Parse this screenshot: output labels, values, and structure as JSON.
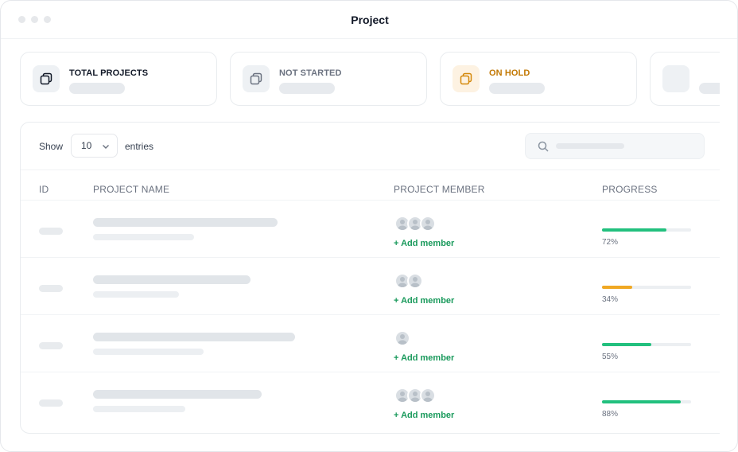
{
  "window": {
    "title": "Project"
  },
  "cards": [
    {
      "label": "TOTAL PROJECTS",
      "icon": "stack-icon",
      "color": "#111827"
    },
    {
      "label": "NOT STARTED",
      "icon": "stack-icon",
      "color": "#6b7280"
    },
    {
      "label": "ON HOLD",
      "icon": "stack-icon",
      "color": "#c27803"
    },
    {
      "label": "",
      "icon": "",
      "color": "#6b7280"
    }
  ],
  "controls": {
    "show_label": "Show",
    "entries_value": "10",
    "entries_label": "entries",
    "search_icon": "search-icon"
  },
  "table": {
    "headers": {
      "id": "ID",
      "name": "PROJECT NAME",
      "member": "PROJECT MEMBER",
      "progress": "PROGRESS"
    },
    "add_member_label": "+ Add member",
    "rows": [
      {
        "members": 3,
        "progress": 72,
        "progress_label": "72%",
        "bar_color": "#22c07e"
      },
      {
        "members": 2,
        "progress": 34,
        "progress_label": "34%",
        "bar_color": "#f0a823"
      },
      {
        "members": 1,
        "progress": 55,
        "progress_label": "55%",
        "bar_color": "#22c07e"
      },
      {
        "members": 3,
        "progress": 88,
        "progress_label": "88%",
        "bar_color": "#22c07e"
      }
    ]
  }
}
